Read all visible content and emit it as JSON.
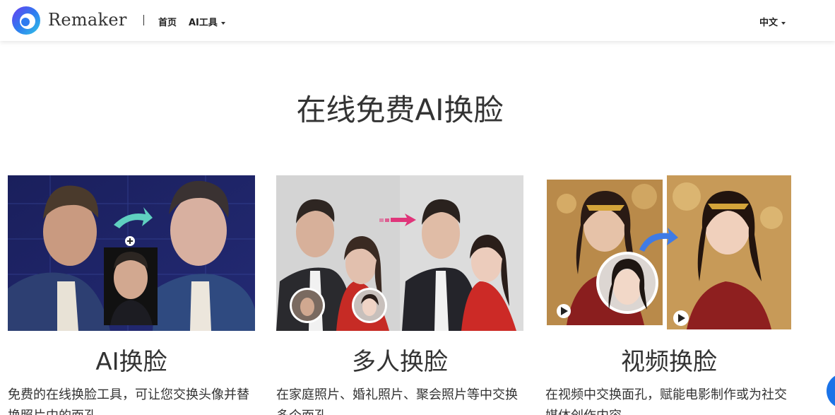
{
  "header": {
    "brand": "Remaker",
    "nav_home": "首页",
    "nav_tools": "AI工具",
    "language": "中文"
  },
  "main": {
    "title": "在线免费AI换脸",
    "cards": [
      {
        "title": "AI换脸",
        "description": "免费的在线换脸工具，可让您交换头像并替换照片中的面孔"
      },
      {
        "title": "多人换脸",
        "description": "在家庭照片、婚礼照片、聚会照片等中交换多个面孔"
      },
      {
        "title": "视频换脸",
        "description": "在视频中交换面孔，赋能电影制作或为社交媒体创作内容"
      }
    ]
  },
  "colors": {
    "accent": "#1a73e8",
    "arrow_teal": "#5fd0c0",
    "arrow_pink": "#e0357a",
    "arrow_blue": "#3f7be6"
  }
}
